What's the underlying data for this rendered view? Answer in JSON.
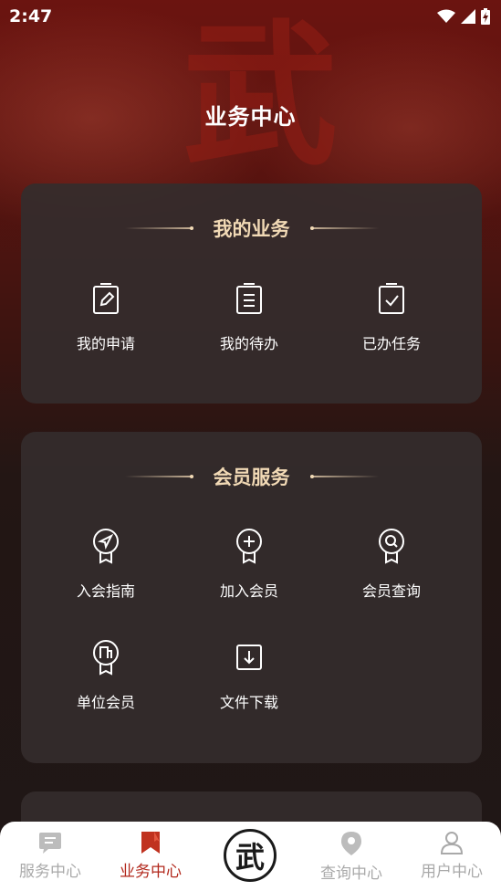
{
  "status_bar": {
    "time": "2:47"
  },
  "header": {
    "title": "业务中心",
    "background_glyph": "武"
  },
  "my_business": {
    "title": "我的业务",
    "items": [
      {
        "label": "我的申请",
        "icon": "clipboard-edit-icon"
      },
      {
        "label": "我的待办",
        "icon": "clipboard-list-icon"
      },
      {
        "label": "已办任务",
        "icon": "clipboard-check-icon"
      }
    ]
  },
  "member_services": {
    "title": "会员服务",
    "items": [
      {
        "label": "入会指南",
        "icon": "badge-compass-icon"
      },
      {
        "label": "加入会员",
        "icon": "badge-plus-icon"
      },
      {
        "label": "会员查询",
        "icon": "badge-search-icon"
      },
      {
        "label": "单位会员",
        "icon": "badge-building-icon"
      },
      {
        "label": "文件下载",
        "icon": "download-icon"
      }
    ]
  },
  "tab_bar": {
    "tabs": [
      {
        "label": "服务中心",
        "icon": "chat-bubble-icon",
        "active": false
      },
      {
        "label": "业务中心",
        "icon": "bookmark-icon",
        "active": true
      },
      {
        "label": "",
        "icon": "wu-logo-icon",
        "center_glyph": "武"
      },
      {
        "label": "查询中心",
        "icon": "location-pin-icon",
        "active": false
      },
      {
        "label": "用户中心",
        "icon": "user-icon",
        "active": false
      }
    ],
    "active_color": "#b2281c",
    "inactive_color": "#a9a9a9"
  },
  "colors": {
    "card_title": "#f1d9b5",
    "background_top": "#6b1410"
  }
}
